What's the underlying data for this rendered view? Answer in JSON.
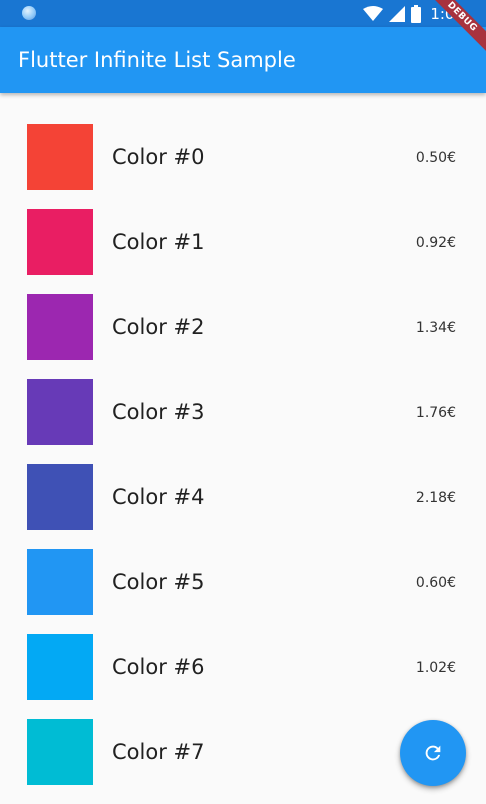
{
  "status_bar": {
    "time": "1:07",
    "icons": [
      "wifi-icon",
      "signal-icon",
      "battery-icon"
    ]
  },
  "debug_banner": "DEBUG",
  "app_bar": {
    "title": "Flutter Infinite List Sample"
  },
  "list": {
    "items": [
      {
        "label": "Color #0",
        "price": "0.50€",
        "color": "#f44336"
      },
      {
        "label": "Color #1",
        "price": "0.92€",
        "color": "#e91e63"
      },
      {
        "label": "Color #2",
        "price": "1.34€",
        "color": "#9c27b0"
      },
      {
        "label": "Color #3",
        "price": "1.76€",
        "color": "#673ab7"
      },
      {
        "label": "Color #4",
        "price": "2.18€",
        "color": "#3f51b5"
      },
      {
        "label": "Color #5",
        "price": "0.60€",
        "color": "#2196f3"
      },
      {
        "label": "Color #6",
        "price": "1.02€",
        "color": "#03a9f4"
      },
      {
        "label": "Color #7",
        "price": "",
        "color": "#00bcd4"
      }
    ]
  },
  "fab": {
    "icon": "refresh-icon",
    "color": "#2196f3"
  },
  "colors": {
    "status_bar": "#1976d2",
    "app_bar": "#2196f3",
    "background": "#fafafa",
    "debug_ribbon": "#a8323e"
  }
}
